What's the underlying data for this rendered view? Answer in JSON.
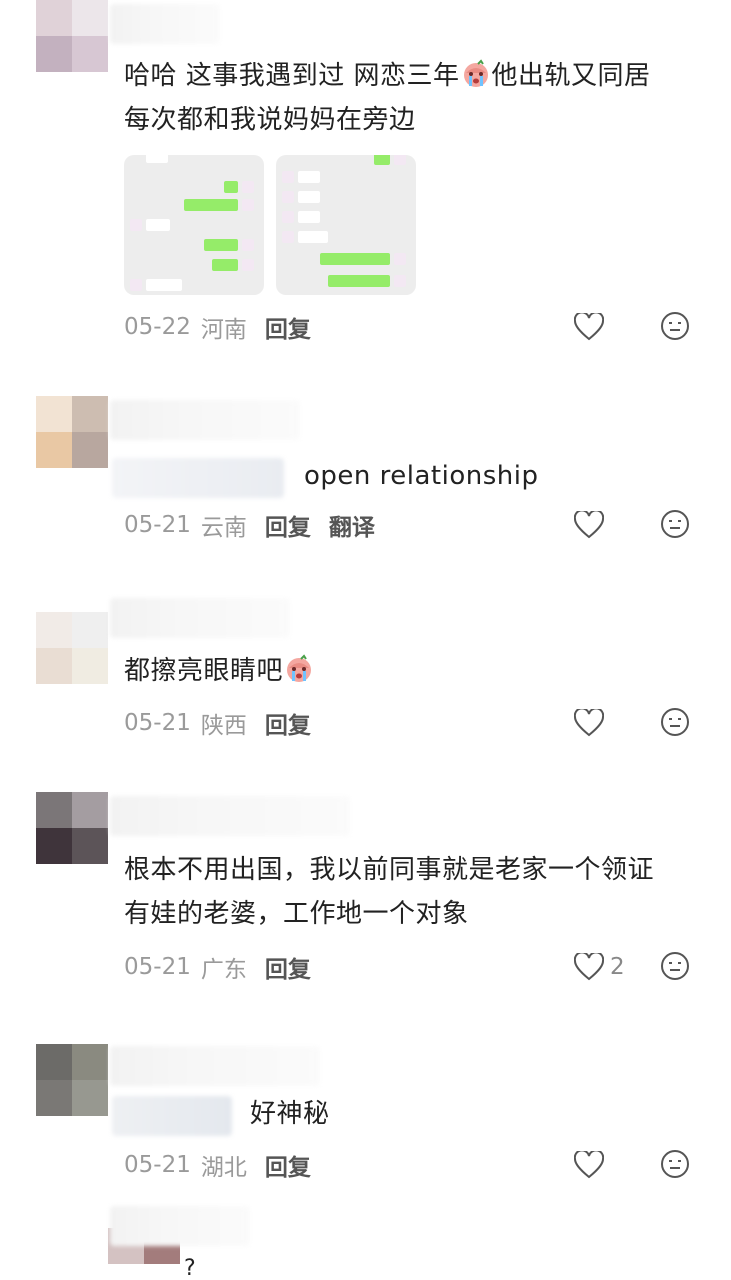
{
  "comments": [
    {
      "text_line1_pre": "哈哈 这事我遇到过 网恋三年",
      "text_line1_post": "他出轨又同居",
      "text_line2": "每次都和我说妈妈在旁边",
      "date": "05-22",
      "region": "河南",
      "reply_label": "回复",
      "emoji": "crying-face-emoji",
      "avatar_colors": [
        "#e0d2d8",
        "#ece6ea",
        "#c3b1bf",
        "#d7c7d3"
      ]
    },
    {
      "text": "open relationship",
      "date": "05-21",
      "region": "云南",
      "reply_label": "回复",
      "translate_label": "翻译",
      "avatar_colors": [
        "#f2e3d3",
        "#cdbdb1",
        "#e9c8a4",
        "#b8a79f"
      ]
    },
    {
      "text": "都擦亮眼睛吧",
      "date": "05-21",
      "region": "陕西",
      "reply_label": "回复",
      "emoji": "crying-face-emoji",
      "avatar_colors": [
        "#f1ebe7",
        "#efefef",
        "#e9ddd3",
        "#f0ece2"
      ]
    },
    {
      "text_line1": "根本不用出国，我以前同事就是老家一个领证",
      "text_line2": "有娃的老婆，工作地一个对象",
      "date": "05-21",
      "region": "广东",
      "reply_label": "回复",
      "like_count": "2",
      "avatar_colors": [
        "#7b7678",
        "#a49da1",
        "#3f343b",
        "#5c5458"
      ]
    },
    {
      "text": "好神秘",
      "date": "05-21",
      "region": "湖北",
      "reply_label": "回复",
      "avatar_colors": [
        "#6c6b68",
        "#8a8a80",
        "#7a7875",
        "#979890"
      ]
    }
  ],
  "partial_comment": {
    "text": "?",
    "avatar_colors": [
      "#d4c2c2",
      "#a37c7c"
    ]
  },
  "colors": {
    "text": "#222222",
    "meta": "#9a9a9a",
    "accent_green": "#95ec69"
  }
}
